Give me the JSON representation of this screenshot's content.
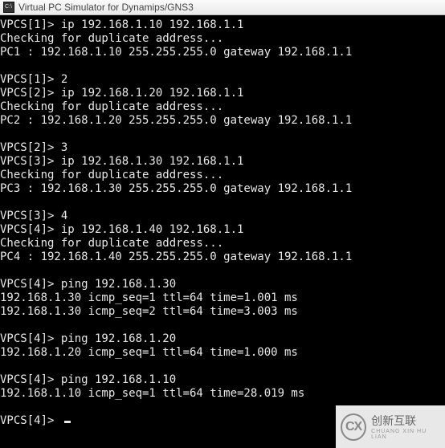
{
  "window": {
    "title": "Virtual PC Simulator for Dynamips/GNS3"
  },
  "terminal": {
    "lines": [
      {
        "type": "prompt",
        "host": "VPCS",
        "idx": "1",
        "cmd": "ip 192.168.1.10 192.168.1.1"
      },
      {
        "type": "text",
        "text": "Checking for duplicate address..."
      },
      {
        "type": "text",
        "text": "PC1 : 192.168.1.10 255.255.255.0 gateway 192.168.1.1"
      },
      {
        "type": "blank"
      },
      {
        "type": "prompt",
        "host": "VPCS",
        "idx": "1",
        "cmd": "2"
      },
      {
        "type": "prompt",
        "host": "VPCS",
        "idx": "2",
        "cmd": "ip 192.168.1.20 192.168.1.1"
      },
      {
        "type": "text",
        "text": "Checking for duplicate address..."
      },
      {
        "type": "text",
        "text": "PC2 : 192.168.1.20 255.255.255.0 gateway 192.168.1.1"
      },
      {
        "type": "blank"
      },
      {
        "type": "prompt",
        "host": "VPCS",
        "idx": "2",
        "cmd": "3"
      },
      {
        "type": "prompt",
        "host": "VPCS",
        "idx": "3",
        "cmd": "ip 192.168.1.30 192.168.1.1"
      },
      {
        "type": "text",
        "text": "Checking for duplicate address..."
      },
      {
        "type": "text",
        "text": "PC3 : 192.168.1.30 255.255.255.0 gateway 192.168.1.1"
      },
      {
        "type": "blank"
      },
      {
        "type": "prompt",
        "host": "VPCS",
        "idx": "3",
        "cmd": "4"
      },
      {
        "type": "prompt",
        "host": "VPCS",
        "idx": "4",
        "cmd": "ip 192.168.1.40 192.168.1.1"
      },
      {
        "type": "text",
        "text": "Checking for duplicate address..."
      },
      {
        "type": "text",
        "text": "PC4 : 192.168.1.40 255.255.255.0 gateway 192.168.1.1"
      },
      {
        "type": "blank"
      },
      {
        "type": "prompt",
        "host": "VPCS",
        "idx": "4",
        "cmd": "ping 192.168.1.30"
      },
      {
        "type": "text",
        "text": "192.168.1.30 icmp_seq=1 ttl=64 time=1.001 ms"
      },
      {
        "type": "text",
        "text": "192.168.1.30 icmp_seq=2 ttl=64 time=3.003 ms"
      },
      {
        "type": "blank"
      },
      {
        "type": "prompt",
        "host": "VPCS",
        "idx": "4",
        "cmd": "ping 192.168.1.20"
      },
      {
        "type": "text",
        "text": "192.168.1.20 icmp_seq=1 ttl=64 time=1.000 ms"
      },
      {
        "type": "blank"
      },
      {
        "type": "prompt",
        "host": "VPCS",
        "idx": "4",
        "cmd": "ping 192.168.1.10"
      },
      {
        "type": "text",
        "text": "192.168.1.10 icmp_seq=1 ttl=64 time=28.019 ms"
      },
      {
        "type": "blank"
      },
      {
        "type": "prompt",
        "host": "VPCS",
        "idx": "4",
        "cmd": "",
        "cursor": true
      }
    ]
  },
  "watermark": {
    "logo": "CX",
    "name": "创新互联",
    "sub": "CHUANG XIN HU LIAN"
  }
}
